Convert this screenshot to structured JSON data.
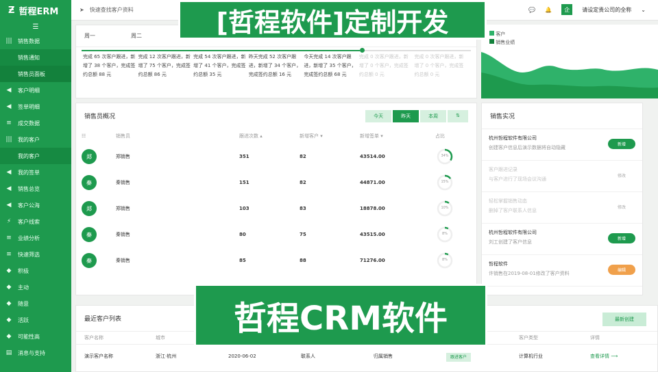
{
  "app": {
    "logo": "哲程ERM",
    "collapse": "☰"
  },
  "sidebar": [
    {
      "label": "销售数据",
      "icon": "|||"
    },
    {
      "label": "销售通知",
      "sub": true
    },
    {
      "label": "销售员面板",
      "sub": true,
      "active": true
    },
    {
      "label": "客户明细",
      "icon": "◀"
    },
    {
      "label": "签单明细",
      "icon": "◀"
    },
    {
      "label": "成交数据",
      "icon": "≡"
    },
    {
      "label": "我的客户",
      "icon": "|||"
    },
    {
      "label": "我的客户",
      "sub": true
    },
    {
      "label": "我的签单",
      "icon": "◀"
    },
    {
      "label": "销售总览",
      "icon": "◀"
    },
    {
      "label": "客户公海",
      "icon": "◀"
    },
    {
      "label": "客户线索",
      "icon": "⚡"
    },
    {
      "label": "业绩分析",
      "icon": "≡"
    },
    {
      "label": "快速筛选",
      "icon": "≡"
    },
    {
      "label": "积极",
      "icon": "◆"
    },
    {
      "label": "主动",
      "icon": "◆"
    },
    {
      "label": "随意",
      "icon": "◆"
    },
    {
      "label": "活跃",
      "icon": "◆"
    },
    {
      "label": "可能性高",
      "icon": "◆"
    },
    {
      "label": "消息与支持",
      "icon": "▤"
    }
  ],
  "topbar": {
    "search_label": "快速查找客户资料",
    "company": "请设定贵公司的全称",
    "avatar": "企"
  },
  "banners": {
    "top": "[哲程软件]定制开发",
    "bottom": "哲程CRM软件"
  },
  "week": {
    "days": [
      "周一",
      "周二"
    ],
    "stats": [
      {
        "t": "完成 65 次客户跟进，新增了 38 个客户，完成签约总额 88 元",
        "faded": false
      },
      {
        "t": "完成 12 次客户跟进，新增了 75 个客户，完成签约总额 86 元",
        "faded": false
      },
      {
        "t": "完成 54 次客户跟进，新增了 41 个客户，完成签约总额 35 元",
        "faded": false
      },
      {
        "t": "昨天完成 52 次客户跟进，新增了 34 个客户，完成签约总额 16 元",
        "faded": false
      },
      {
        "t": "今天完成 14 次客户跟进，新增了 35 个客户，完成签约总额 68 元",
        "faded": false
      },
      {
        "t": "完成 0 次客户跟进，新增了 0 个客户，完成签约总额 0 元",
        "faded": true
      },
      {
        "t": "完成 0 次客户跟进，新增了 0 个客户，完成签约总额 0 元",
        "faded": true
      }
    ]
  },
  "legend": [
    "客户",
    "销售业绩"
  ],
  "salesOverview": {
    "title": "销售员概况",
    "filters": [
      "今天",
      "昨天",
      "本周",
      "⇅"
    ],
    "headers": [
      "销售员",
      "跟进次数 ▴",
      "新增客户 ▾",
      "新增签单 ▾",
      "占比"
    ],
    "rows": [
      {
        "avatar": "郑",
        "name": "郑销售",
        "follow": "351",
        "new": "82",
        "amount": "43514.00",
        "pct": "34%",
        "p": 0.34
      },
      {
        "avatar": "秦",
        "name": "秦销售",
        "follow": "151",
        "new": "82",
        "amount": "44871.00",
        "pct": "15%",
        "p": 0.15
      },
      {
        "avatar": "郑",
        "name": "郑销售",
        "follow": "103",
        "new": "83",
        "amount": "18878.00",
        "pct": "10%",
        "p": 0.1
      },
      {
        "avatar": "秦",
        "name": "秦销售",
        "follow": "80",
        "new": "75",
        "amount": "43515.00",
        "pct": "8%",
        "p": 0.08
      },
      {
        "avatar": "秦",
        "name": "秦销售",
        "follow": "85",
        "new": "88",
        "amount": "71276.00",
        "pct": "8%",
        "p": 0.08
      }
    ]
  },
  "log": {
    "title": "销售实况",
    "items": [
      {
        "title": "杭州哲程软件有限公司",
        "desc": "创建客户信息后演示数据将自动隐藏",
        "tag": "新增",
        "style": "",
        "faded": false
      },
      {
        "title": "客户跟进记录",
        "desc": "与客户进行了现场会议沟通",
        "tag": "修改",
        "style": "grey",
        "faded": true
      },
      {
        "title": "轻松掌握销售动态",
        "desc": "删掉了客户联系人信息",
        "tag": "修改",
        "style": "grey",
        "faded": true
      },
      {
        "title": "杭州哲程软件有限公司",
        "desc": "刘工创建了客户信息",
        "tag": "新增",
        "style": "",
        "faded": false
      },
      {
        "title": "哲程软件",
        "desc": "许销售在2019-08-01修改了客户资料",
        "tag": "编辑",
        "style": "orange",
        "faded": false
      }
    ]
  },
  "recent": {
    "title": "最近客户列表",
    "create": "最新创建",
    "headers": [
      "客户名称",
      "城市",
      "",
      "",
      "",
      "",
      "客户类型",
      "详情"
    ],
    "row": {
      "name": "演示客户名称",
      "city": "浙江·杭州",
      "date": "2020-06-02",
      "contact": "联系人",
      "owner": "归属销售",
      "status": "跟进客户",
      "industry": "计算机行业",
      "detail": "查看详情 ⟶"
    }
  },
  "colors": {
    "accent": "#1e9a4e"
  }
}
